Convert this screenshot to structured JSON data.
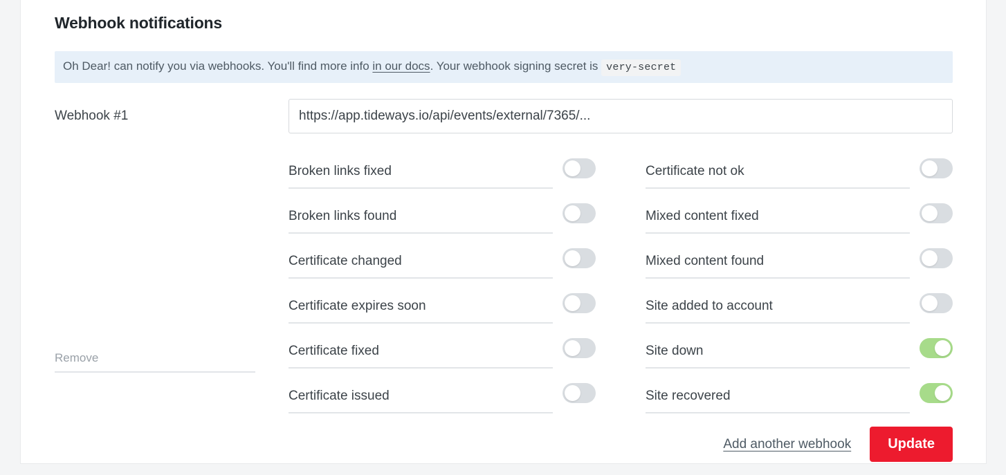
{
  "section": {
    "title": "Webhook notifications"
  },
  "banner": {
    "text_before_link": "Oh Dear! can notify you via webhooks. You'll find more info ",
    "link_label": "in our docs",
    "text_after_link": ". Your webhook signing secret is ",
    "secret": "very-secret"
  },
  "webhook": {
    "label": "Webhook #1",
    "url": "https://app.tideways.io/api/events/external/7365/...",
    "remove_label": "Remove"
  },
  "notifications": {
    "left_column": [
      {
        "label": "Broken links fixed",
        "enabled": false
      },
      {
        "label": "Broken links found",
        "enabled": false
      },
      {
        "label": "Certificate changed",
        "enabled": false
      },
      {
        "label": "Certificate expires soon",
        "enabled": false
      },
      {
        "label": "Certificate fixed",
        "enabled": false
      },
      {
        "label": "Certificate issued",
        "enabled": false
      }
    ],
    "right_column": [
      {
        "label": "Certificate not ok",
        "enabled": false
      },
      {
        "label": "Mixed content fixed",
        "enabled": false
      },
      {
        "label": "Mixed content found",
        "enabled": false
      },
      {
        "label": "Site added to account",
        "enabled": false
      },
      {
        "label": "Site down",
        "enabled": true
      },
      {
        "label": "Site recovered",
        "enabled": true
      }
    ]
  },
  "footer": {
    "add_webhook_label": "Add another webhook",
    "update_label": "Update"
  },
  "colors": {
    "accent_red": "#ed1b2e",
    "toggle_on_green": "#a7db8a",
    "toggle_off_grey": "#d9dde1",
    "banner_bg": "#e7f0f9"
  }
}
